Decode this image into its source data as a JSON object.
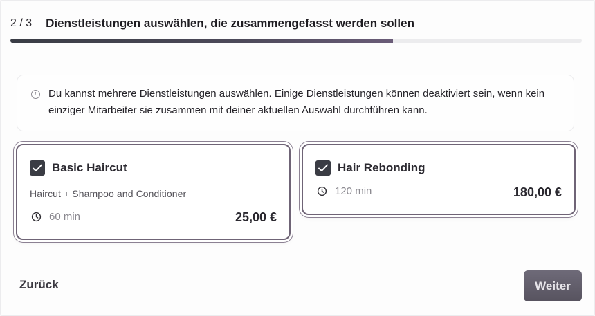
{
  "header": {
    "step": "2 / 3",
    "title": "Dienstleistungen auswählen, die zusammengefasst werden sollen"
  },
  "progress": {
    "value": 0.67
  },
  "info": {
    "icon": "info-icon",
    "text": "Du kannst mehrere Dienstleistungen auswählen. Einige Dienstleistungen können deaktiviert sein, wenn kein einziger Mitarbeiter sie zusammen mit deiner aktuellen Auswahl durchführen kann."
  },
  "services": [
    {
      "name": "Basic Haircut",
      "description": "Haircut + Shampoo and Conditioner",
      "duration": "60 min",
      "price": "25,00 €",
      "checked": true
    },
    {
      "name": "Hair Rebonding",
      "duration": "120 min",
      "price": "180,00 €",
      "checked": true
    }
  ],
  "footer": {
    "back_label": "Zurück",
    "next_label": "Weiter"
  },
  "colors": {
    "accent": "#3a3c44",
    "card_border": "#6f6476",
    "next_button": "#5f5b68"
  }
}
